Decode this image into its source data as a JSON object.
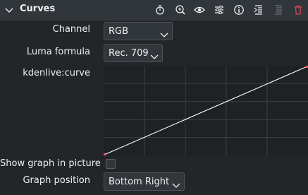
{
  "panel": {
    "title": "Curves"
  },
  "toolbar": {
    "icons": [
      "timer-icon",
      "zoom-icon",
      "eye-icon",
      "sliders-icon",
      "info-icon",
      "collapse-icon",
      "group-icon",
      "trash-icon"
    ]
  },
  "params": {
    "channel_label": "Channel",
    "channel_value": "RGB",
    "luma_label": "Luma formula",
    "luma_value": "Rec. 709",
    "curve_label": "kdenlive:curve",
    "show_graph_label": "Show graph in picture",
    "show_graph_checked": false,
    "graph_position_label": "Graph position",
    "graph_position_value": "Bottom Right"
  },
  "colors": {
    "accent_delete": "#da4453",
    "point": "#ff4d6a",
    "curve_line": "#ffffff"
  }
}
